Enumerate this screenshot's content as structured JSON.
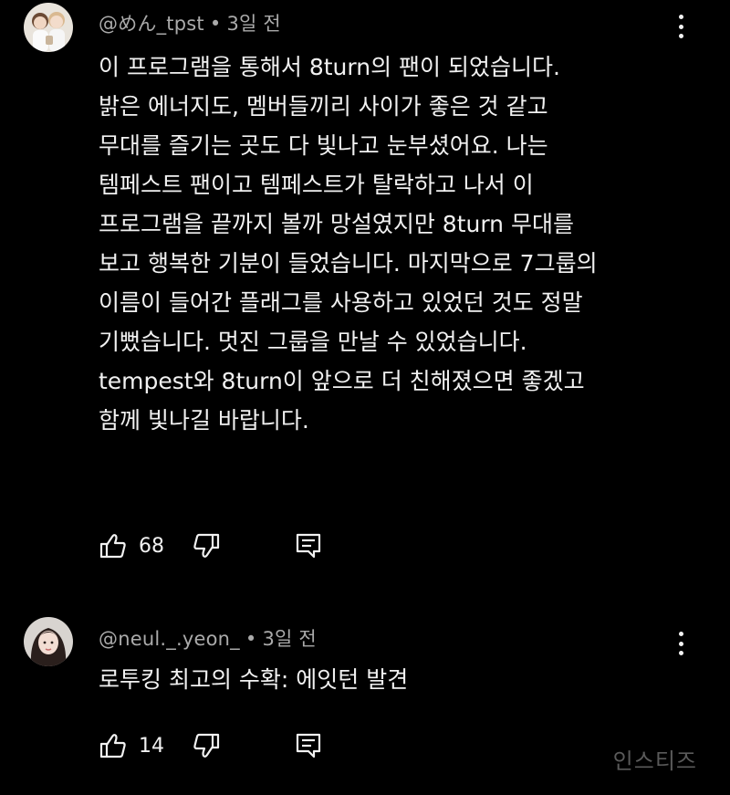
{
  "comments": [
    {
      "author": "@めん_tpst",
      "separator": "•",
      "time": "3일 전",
      "lines": [
        "이 프로그램을 통해서 8turn의 팬이 되었습니다.",
        "밝은 에너지도, 멤버들끼리 사이가 좋은 것 같고",
        "무대를 즐기는 곳도 다 빛나고 눈부셨어요. 나는",
        "템페스트 팬이고 템페스트가 탈락하고 나서 이",
        "프로그램을 끝까지 볼까 망설였지만 8turn 무대를",
        "보고 행복한 기분이 들었습니다. 마지막으로 7그룹의",
        "이름이 들어간 플래그를 사용하고 있었던 것도 정말",
        "기뻤습니다. 멋진 그룹을 만날 수 있었습니다.",
        "tempest와 8turn이 앞으로 더 친해졌으면 좋겠고",
        "함께 빛나길 바랍니다."
      ],
      "likes": "68"
    },
    {
      "author": "@neul._.yeon_",
      "separator": "•",
      "time": "3일 전",
      "lines": [
        "로투킹 최고의 수확: 에잇턴 발견"
      ],
      "likes": "14"
    }
  ],
  "icons": {
    "like": "thumbs-up-icon",
    "dislike": "thumbs-down-icon",
    "reply": "reply-icon",
    "more": "more-vert-icon"
  },
  "watermark": "인스티즈",
  "colors": {
    "background": "#000000",
    "text": "#f1f1f1",
    "meta": "#aaaaaa",
    "watermark": "#5a5a5a"
  }
}
